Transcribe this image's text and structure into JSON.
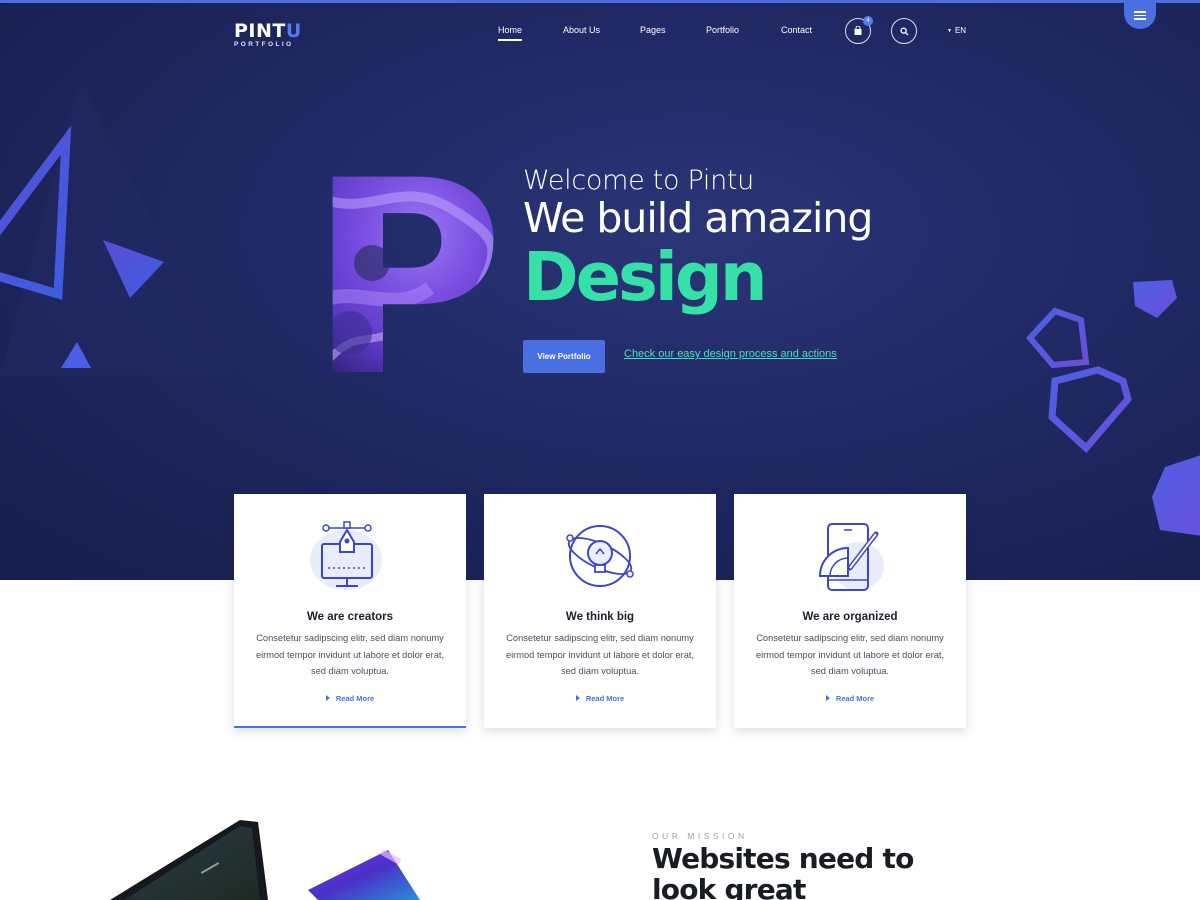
{
  "header": {
    "logo": {
      "brand_main": "PINT",
      "brand_accent": "U",
      "tagline": "PORTFOLIO"
    },
    "nav": [
      {
        "label": "Home",
        "active": true
      },
      {
        "label": "About Us",
        "active": false
      },
      {
        "label": "Pages",
        "active": false
      },
      {
        "label": "Portfolio",
        "active": false
      },
      {
        "label": "Contact",
        "active": false
      }
    ],
    "cart_count": "4",
    "language": "EN",
    "icons": [
      "cart-icon",
      "search-icon",
      "caret-down-icon",
      "hamburger-menu-icon"
    ]
  },
  "hero": {
    "welcome": "Welcome to Pintu",
    "headline": "We build amazing",
    "highlight": "Design",
    "big_letter": "P",
    "cta_button": "View Portfolio",
    "cta_link": "Check our easy design process and actions"
  },
  "features": [
    {
      "title": "We are creators",
      "text": "Consetetur sadipscing elitr, sed diam nonumy eirmod tempor invidunt ut labore et dolor erat, sed diam voluptua.",
      "link": "Read More",
      "icon": "pen-tool-monitor-icon"
    },
    {
      "title": "We think big",
      "text": "Consetetur sadipscing elitr, sed diam nonumy eirmod tempor invidunt ut labore et dolor erat, sed diam voluptua.",
      "link": "Read More",
      "icon": "lightbulb-orbit-icon"
    },
    {
      "title": "We are organized",
      "text": "Consetetur sadipscing elitr, sed diam nonumy eirmod tempor invidunt ut labore et dolor erat, sed diam voluptua.",
      "link": "Read More",
      "icon": "phone-ruler-pencil-icon"
    }
  ],
  "mission": {
    "kicker": "OUR MISSION",
    "title": "Websites need to look great"
  },
  "colors": {
    "hero_bg": "#1f2760",
    "accent_blue": "#4a6fe0",
    "accent_green": "#35e1a6",
    "icon_blue": "#3c46c8"
  }
}
